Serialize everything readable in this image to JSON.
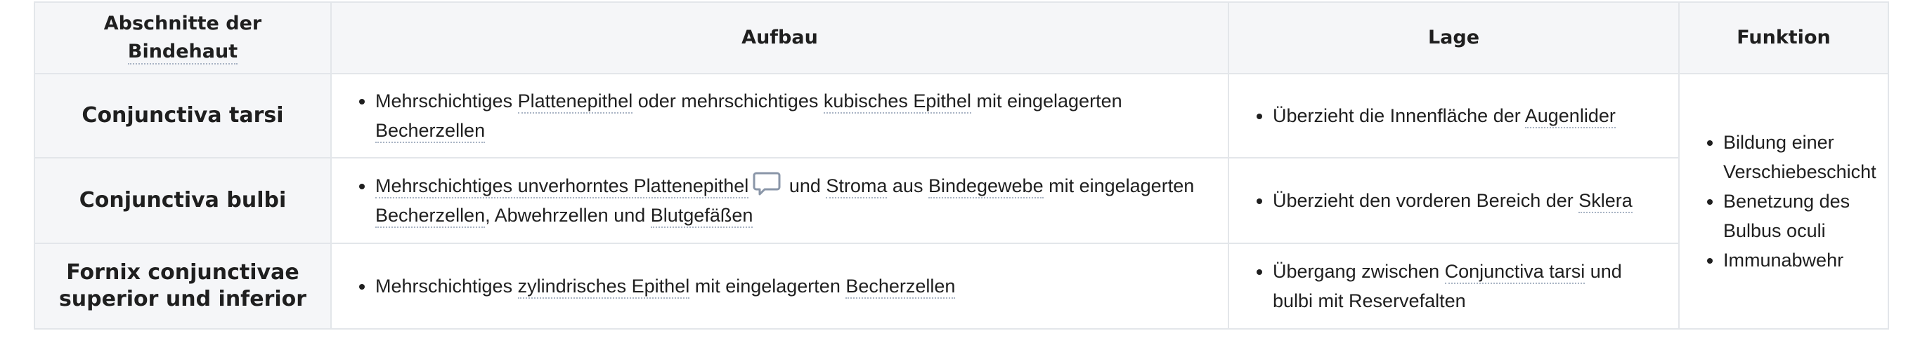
{
  "table": {
    "headers": {
      "c1_pre": "Abschnitte der ",
      "c1_link": "Bindehaut",
      "c2": "Aufbau",
      "c3": "Lage",
      "c4": "Funktion"
    },
    "rows": [
      {
        "name": "Conjunctiva tarsi",
        "aufbau": {
          "t1": "Mehrschichtiges ",
          "l1": "Plattenepithel",
          "t2": " oder mehrschichtiges ",
          "l2": "kubisches Epithel",
          "t3": " mit eingelagerten ",
          "l3": "Becherzellen"
        },
        "lage": {
          "t1": "Überzieht die Innenfläche der ",
          "l1": "Augenlider"
        }
      },
      {
        "name": "Conjunctiva bulbi",
        "aufbau": {
          "l1": "Mehrschichtiges unverhorntes Plattenepithel",
          "t1": " und ",
          "l2": "Stroma",
          "t2": " aus ",
          "l3": "Bindegewebe",
          "t3": " mit eingelagerten ",
          "l4": "Becherzellen",
          "t4": ", Abwehrzellen und ",
          "l5": "Blutgefäßen"
        },
        "lage": {
          "t1": "Überzieht den vorderen Bereich der ",
          "l1": "Sklera"
        }
      },
      {
        "name_line1": "Fornix conjunctivae",
        "name_line2": "superior und inferior",
        "aufbau": {
          "t1": "Mehrschichtiges ",
          "l1": "zylindrisches Epithel",
          "t2": " mit eingelagerten ",
          "l2": "Becherzellen"
        },
        "lage": {
          "t1": "Übergang zwischen ",
          "l1": "Conjunctiva tarsi",
          "t2": " und bulbi mit Reservefalten"
        }
      }
    ],
    "funktion": [
      "Bildung einer Verschiebeschicht",
      "Benetzung des Bulbus oculi",
      "Immunabwehr"
    ]
  },
  "icons": {
    "comment": "speech-bubble-icon"
  },
  "colors": {
    "header_bg": "#f5f6f8",
    "border": "#e3e6ea",
    "link_underline": "#a9b4c4",
    "icon": "#8a96a8"
  }
}
